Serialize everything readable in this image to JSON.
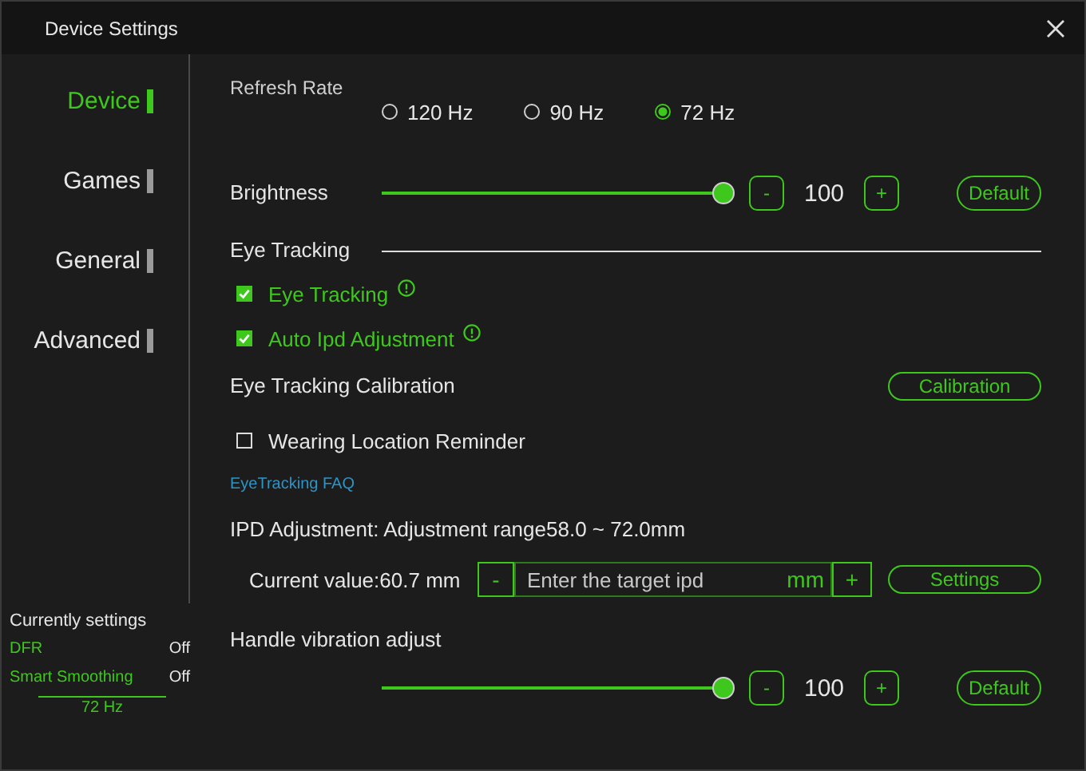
{
  "window": {
    "title": "Device Settings"
  },
  "sidebar": {
    "items": [
      {
        "label": "Device",
        "selected": true
      },
      {
        "label": "Games",
        "selected": false
      },
      {
        "label": "General",
        "selected": false
      },
      {
        "label": "Advanced",
        "selected": false
      }
    ]
  },
  "current_settings": {
    "title": "Currently settings",
    "rows": [
      {
        "label": "DFR",
        "value": "Off"
      },
      {
        "label": "Smart Smoothing",
        "value": "Off"
      }
    ],
    "refresh": "72 Hz"
  },
  "refresh_rate": {
    "label": "Refresh Rate",
    "options": [
      {
        "label": "120 Hz",
        "selected": false
      },
      {
        "label": "90 Hz",
        "selected": false
      },
      {
        "label": "72 Hz",
        "selected": true
      }
    ]
  },
  "brightness": {
    "label": "Brightness",
    "level": 1,
    "minus": "-",
    "value": "100",
    "plus": "+",
    "default_button": "Default"
  },
  "eye_tracking": {
    "heading": "Eye Tracking",
    "options": [
      {
        "label": "Eye Tracking",
        "checked": true
      },
      {
        "label": "Auto Ipd Adjustment",
        "checked": true
      }
    ]
  },
  "calibration": {
    "label": "Eye Tracking Calibration",
    "button": "Calibration"
  },
  "wearing_reminder": {
    "label": "Wearing Location Reminder",
    "checked": false
  },
  "faq_link": "EyeTracking FAQ",
  "ipd": {
    "label": "IPD Adjustment: Adjustment range58.0 ~ 72.0mm",
    "current": "Current value:60.7 mm",
    "minus": "-",
    "placeholder": "Enter the target ipd",
    "unit": "mm",
    "plus": "+",
    "button": "Settings"
  },
  "vibration": {
    "label": "Handle vibration adjust",
    "level": 1,
    "minus": "-",
    "value": "100",
    "plus": "+",
    "default_button": "Default"
  }
}
